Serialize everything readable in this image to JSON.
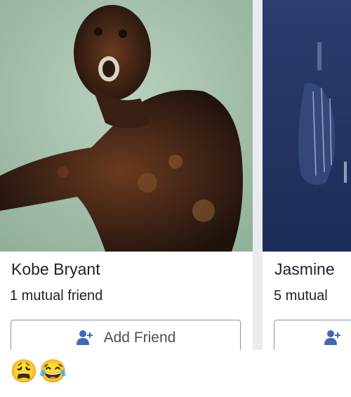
{
  "suggestions": [
    {
      "name": "Kobe Bryant",
      "mutual": "1 mutual friend",
      "button_label": "Add Friend",
      "button_icon": "add-friend-icon"
    },
    {
      "name": "Jasmine",
      "mutual": "5 mutual",
      "button_label": "",
      "button_icon": "add-friend-icon"
    }
  ],
  "reactions": [
    "😩",
    "😂"
  ],
  "colors": {
    "accent": "#4267b2",
    "text": "#1d2129",
    "button_border": "#8d949e",
    "background": "#e9ebee"
  }
}
